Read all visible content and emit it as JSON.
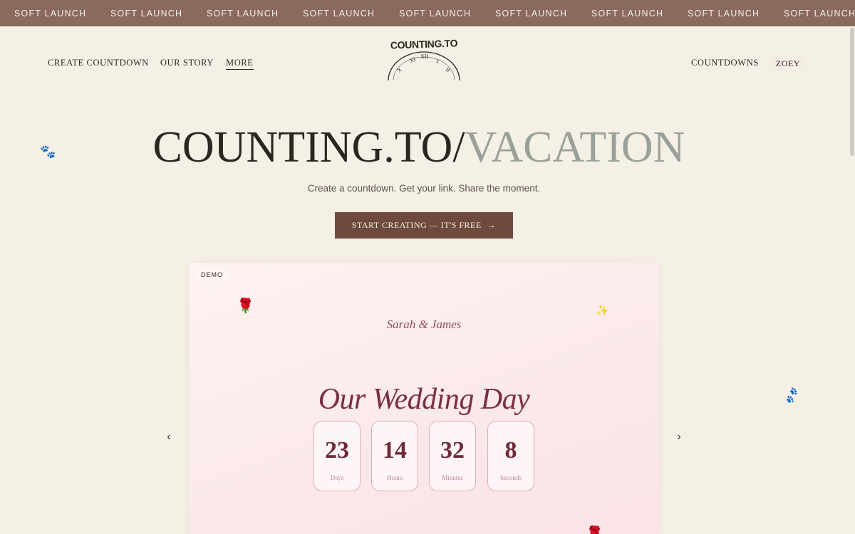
{
  "marquee": {
    "items": [
      "SOFT LAUNCH",
      "SOFT LAUNCH",
      "SOFT LAUNCH",
      "SOFT LAUNCH",
      "SOFT LAUNCH",
      "SOFT LAUNCH",
      "SOFT LAUNCH",
      "SOFT LAUNCH",
      "SOFT LAUNCH"
    ]
  },
  "nav": {
    "create": "CREATE COUNTDOWN",
    "story": "OUR STORY",
    "more": "MORE",
    "countdowns": "COUNTDOWNS",
    "user": "ZOEY"
  },
  "logo": {
    "text": "COUNTING.TO"
  },
  "hero": {
    "title_main": "COUNTING.TO/",
    "title_accent": "VACATION",
    "tagline": "Create a countdown. Get your link. Share the moment.",
    "cta": "START CREATING — IT'S FREE",
    "cta_icon": "arrow-right-icon"
  },
  "demo": {
    "badge": "DEMO",
    "couple": "Sarah & James",
    "title": "Our Wedding Day",
    "tiles": [
      {
        "value": "23",
        "label": "Days"
      },
      {
        "value": "14",
        "label": "Hours"
      },
      {
        "value": "32",
        "label": "Minutes"
      },
      {
        "value": "8",
        "label": "Seconds"
      }
    ]
  },
  "carousel": {
    "prev": "‹",
    "next": "›"
  },
  "colors": {
    "background": "#f5f0e6",
    "marquee": "#8a6a5e",
    "cta": "#6e4a3c",
    "accent_title": "#9aa19a",
    "wedding": "#7b2f42"
  }
}
